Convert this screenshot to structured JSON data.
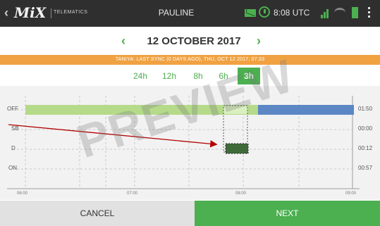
{
  "colors": {
    "accent": "#4caf50",
    "sync_bar": "#f0a242",
    "topbar_bg": "#2f2f2f",
    "off_bar": "#b5da8a",
    "on_bar": "#5b87c5",
    "arrow": "#b30000"
  },
  "header": {
    "back_icon": "‹",
    "logo": "MiX",
    "logo_sub": "TELEMATICS",
    "vehicle": "PAULINE",
    "time": "8:08 UTC"
  },
  "date_nav": {
    "prev_icon": "‹",
    "date": "12 OCTOBER 2017",
    "next_icon": "›"
  },
  "sync_text": "TANIYA: LAST SYNC (0 DAYS AGO), THU, OCT 12 2017, 07:33",
  "zoom": {
    "options": [
      "24h",
      "12h",
      "8h",
      "6h",
      "3h"
    ],
    "selected": "3h"
  },
  "chart": {
    "row_labels": [
      "OFF",
      "SB",
      "D",
      "ON"
    ],
    "durations": [
      "01:50",
      "00:00",
      "00:12",
      "00:57"
    ],
    "time_ticks": [
      "06:00",
      "07:00",
      "08:00",
      "09:00"
    ]
  },
  "watermark": "PREVIEW",
  "buttons": {
    "cancel": "CANCEL",
    "next": "NEXT"
  }
}
